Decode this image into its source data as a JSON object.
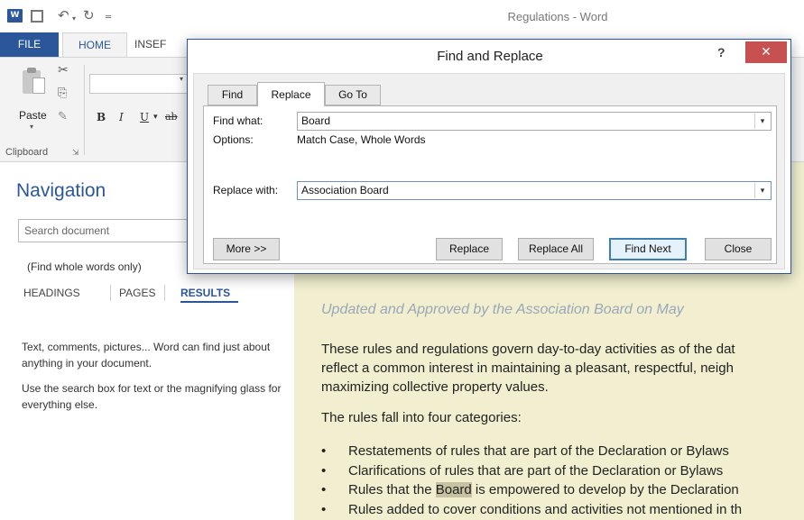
{
  "window": {
    "title": "Regulations - Word",
    "app_icon": "W",
    "qat_icons": [
      "save-icon",
      "undo-icon",
      "redo-icon",
      "customize-icon"
    ]
  },
  "ribbon": {
    "tabs": {
      "file": "FILE",
      "home": "HOME",
      "insert": "INSEF"
    },
    "paste_label": "Paste",
    "clipboard_label": "Clipboard",
    "format_buttons": {
      "bold": "B",
      "italic": "I",
      "underline": "U",
      "strike": "ab"
    }
  },
  "navigation": {
    "title": "Navigation",
    "search_placeholder": "Search document",
    "whole_words_note": "(Find whole words only)",
    "tabs": {
      "headings": "HEADINGS",
      "pages": "PAGES",
      "results": "RESULTS"
    },
    "help_1": "Text, comments, pictures... Word can find just about anything in your document.",
    "help_2": "Use the search box for text or the magnifying glass for everything else."
  },
  "dialog": {
    "title": "Find and Replace",
    "help": "?",
    "close": "✕",
    "tabs": {
      "find": "Find",
      "replace": "Replace",
      "goto": "Go To"
    },
    "find_label": "Find what:",
    "find_value": "Board",
    "options_label": "Options:",
    "options_value": "Match Case, Whole Words",
    "replace_label": "Replace with:",
    "replace_value": "Association Board",
    "buttons": {
      "more": "More >>",
      "replace": "Replace",
      "replace_all": "Replace All",
      "find_next": "Find Next",
      "close": "Close"
    }
  },
  "document": {
    "heading": "Updated and Approved by the Association Board on May",
    "para1_line1": "These rules and regulations govern day-to-day activities as of the dat",
    "para1_line2": "reflect a common interest in maintaining a pleasant, respectful, neigh",
    "para1_line3": "maximizing collective property values.",
    "para2": "The rules fall into four categories:",
    "bullets": [
      "Restatements of rules that are part of the Declaration or Bylaws",
      "Clarifications of rules that are part of the Declaration or Bylaws",
      "Rules that the ",
      "Rules added to cover conditions and activities not mentioned in th"
    ],
    "bullet3_highlight": "Board",
    "bullet3_rest": " is empowered to develop by the Declaration"
  }
}
